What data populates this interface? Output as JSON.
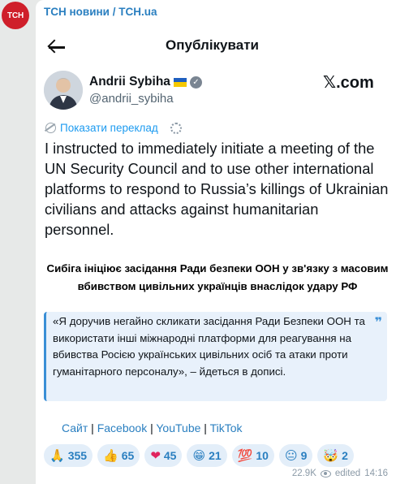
{
  "channel": {
    "avatar_text": "ТСН",
    "name": "ТСН новини / ТСН.ua"
  },
  "post_header": {
    "title": "Опублікувати"
  },
  "author": {
    "name": "Andrii Sybiha",
    "handle": "@andrii_sybiha",
    "platform": "𝕏.com"
  },
  "translate_label": "Показати переклад",
  "tweet_text": "I instructed to immediately initiate a meeting of the UN Security Council and to use other international platforms to respond to Russia’s killings of Ukrainian civilians and attacks against humanitarian personnel.",
  "headline": "Сибіга ініціює засідання Ради безпеки ООН у зв'язку з масовим вбивством цивільних українців внаслідок удару РФ",
  "quote": "«Я доручив негайно скликати засідання Ради Безпеки ООН та використати інші міжнародні платформи для реагування на вбивства Росією українських цивільних осіб та атаки проти гуманітарного персоналу», – йдеться в дописі.",
  "links": {
    "site": "Сайт",
    "facebook": "Facebook",
    "youtube": "YouTube",
    "tiktok": "TikTok"
  },
  "reactions": [
    {
      "emoji": "🙏",
      "count": "355"
    },
    {
      "emoji": "👍",
      "count": "65"
    },
    {
      "emoji": "❤",
      "count": "45"
    },
    {
      "emoji": "😁",
      "count": "21"
    },
    {
      "emoji": "💯",
      "count": "10"
    },
    {
      "emoji": "😐",
      "count": "9"
    },
    {
      "emoji": "🤯",
      "count": "2"
    }
  ],
  "meta": {
    "views": "22.9K",
    "status": "edited",
    "time": "14:16"
  }
}
